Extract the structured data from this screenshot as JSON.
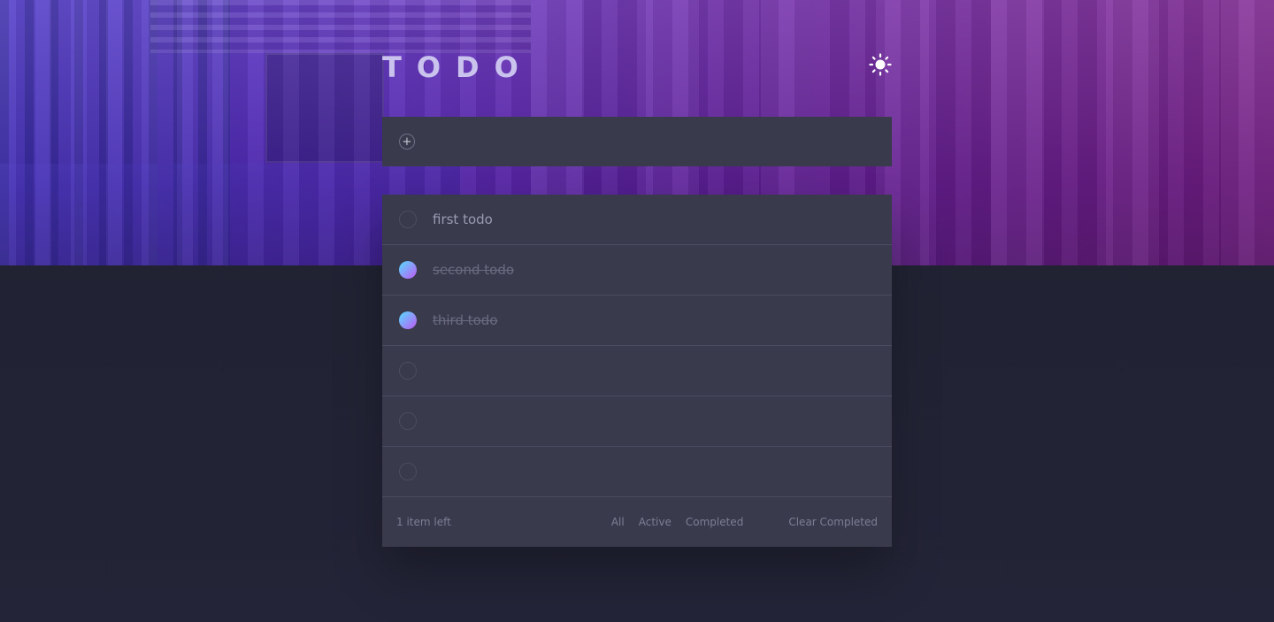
{
  "app": {
    "title": "TODO",
    "theme_icon": "sun-icon"
  },
  "new_todo": {
    "add_icon": "plus-icon",
    "value": "",
    "placeholder": ""
  },
  "todos": [
    {
      "text": "first todo",
      "completed": false
    },
    {
      "text": "second todo",
      "completed": true
    },
    {
      "text": "third todo",
      "completed": true
    },
    {
      "text": "",
      "completed": false
    },
    {
      "text": "",
      "completed": false
    },
    {
      "text": "",
      "completed": false
    }
  ],
  "footer": {
    "items_left": "1 item left",
    "filters": {
      "all": "All",
      "active": "Active",
      "completed": "Completed"
    },
    "clear_completed": "Clear Completed"
  },
  "colors": {
    "check_gradient_start": "#55ddff",
    "check_gradient_end": "#c058f3",
    "panel": "#393a4b",
    "background": "#1f212f"
  }
}
